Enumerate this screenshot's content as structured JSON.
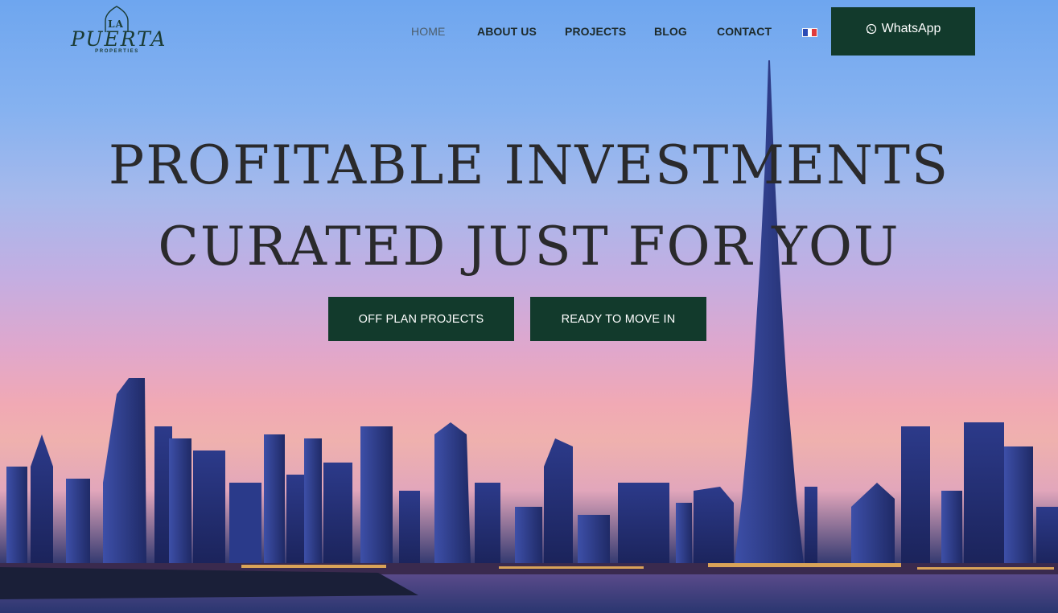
{
  "brand": {
    "logo_top": "LA",
    "logo_main": "PUERTA",
    "logo_sub": "PROPERTIES"
  },
  "nav": {
    "items": [
      {
        "label": "HOME",
        "active": true
      },
      {
        "label": "ABOUT US",
        "active": false
      },
      {
        "label": "PROJECTS",
        "active": false
      },
      {
        "label": "BLOG",
        "active": false
      },
      {
        "label": "CONTACT",
        "active": false
      }
    ],
    "language_flag": "flag-france-icon",
    "whatsapp_label": "WhatsApp",
    "whatsapp_icon": "whatsapp-icon"
  },
  "hero": {
    "headline_line1": "PROFITABLE INVESTMENTS",
    "headline_line2": "CURATED JUST FOR YOU",
    "cta_primary": "OFF PLAN PROJECTS",
    "cta_secondary": "READY TO MOVE IN",
    "background": "dubai-skyline-sunset"
  },
  "colors": {
    "accent": "#123a2c",
    "text_dark": "#2a2a2c",
    "nav_text": "#1d2a2b",
    "nav_active": "#4c5d6a"
  }
}
